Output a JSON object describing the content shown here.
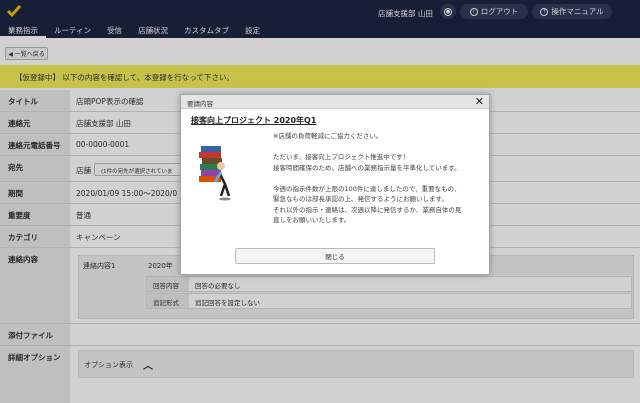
{
  "header": {
    "user_name": "店舗支援部 山田",
    "logout_label": "ログアウト",
    "manual_label": "操作マニュアル",
    "user_icon": "user-icon",
    "power_icon": "power-icon",
    "help_icon": "help-icon"
  },
  "nav": {
    "items": [
      "業務指示",
      "ルーティン",
      "受信",
      "店舗状況",
      "カスタムタブ",
      "設定"
    ],
    "active": "業務指示"
  },
  "back_label": "◀ 一覧へ戻る",
  "notice": "【仮登録中】 以下の内容を確認して、本登録を行なって下さい。",
  "fields": {
    "title_label": "タイトル",
    "title_value": "店頭POP表示の確認",
    "contact_label": "連絡元",
    "contact_value": "店舗支援部 山田",
    "phone_label": "連絡元電話番号",
    "phone_value": "00-0000-0001",
    "dest_label": "宛先",
    "dest_value": "店舗",
    "dest_box": "(1件の宛先が選択されていま",
    "period_label": "期間",
    "period_value": "2020/01/09 15:00〜2020/0",
    "importance_label": "重要度",
    "importance_value": "普通",
    "category_label": "カテゴリ",
    "category_value": "キャンペーン",
    "content_label": "連絡内容",
    "contact_item_name": "連絡内容1",
    "contact_item_date": "2020年",
    "reply_label": "回答内容",
    "reply_value": "回答の必要なし",
    "append_label": "追記形式",
    "append_value": "追記回答を設定しない",
    "attach_label": "添付ファイル",
    "detail_label": "詳細オプション",
    "option_label": "オプション表示"
  },
  "modal": {
    "header": "要請内容",
    "title": "接客向上プロジェクト 2020年Q1",
    "body": [
      "※店舗の負荷軽減にご協力ください。",
      "",
      "ただいま、接客向上プロジェクト推進中です！",
      "接客時間確保のため、店舗への業務指示量を平準化しています。",
      "",
      "今週の指示件数が上限の100件に達しましたので、重要なもの、",
      "緊急なものは部長承認の上、発信するようにお願いします。",
      "それ以外の指示・連絡は、次週以降に発信するか、業務自体の見",
      "直しをお願いいたします。"
    ],
    "close_label": "閉じる"
  }
}
